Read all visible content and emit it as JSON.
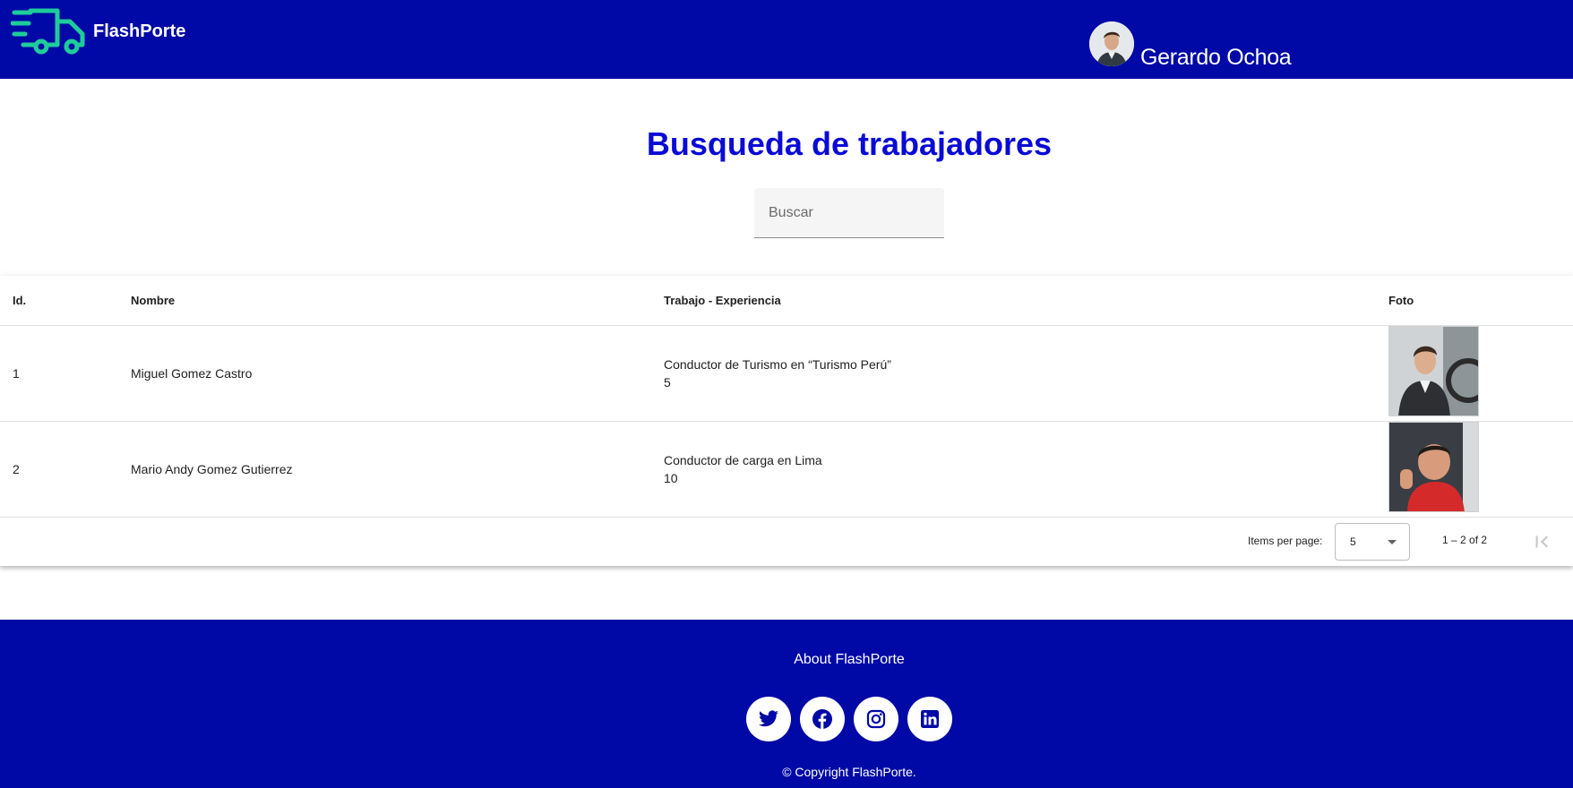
{
  "header": {
    "brand": "FlashPorte",
    "user_name": "Gerardo Ochoa",
    "logo_icon": "delivery-truck-icon",
    "colors": {
      "bar": "#0009A6",
      "logo": "#1ECC9A"
    }
  },
  "page": {
    "title": "Busqueda de trabajadores",
    "title_color": "#0A0AD6"
  },
  "search": {
    "placeholder": "Buscar",
    "value": ""
  },
  "table": {
    "columns": [
      "Id.",
      "Nombre",
      "Trabajo - Experiencia",
      "Foto"
    ],
    "rows": [
      {
        "id": "1",
        "nombre": "Miguel Gomez Castro",
        "trabajo": "Conductor de Turismo en “Turismo Perú”",
        "experiencia": "5"
      },
      {
        "id": "2",
        "nombre": "Mario Andy Gomez Gutierrez",
        "trabajo": "Conductor de carga en Lima",
        "experiencia": "10"
      }
    ],
    "paginator": {
      "items_per_page_label": "Items per page:",
      "items_per_page_value": "5",
      "range_label": "1 – 2 of 2"
    }
  },
  "footer": {
    "about": "About FlashPorte",
    "social": [
      "twitter-icon",
      "facebook-icon",
      "instagram-icon",
      "linkedin-icon"
    ],
    "copyright": "© Copyright FlashPorte."
  }
}
